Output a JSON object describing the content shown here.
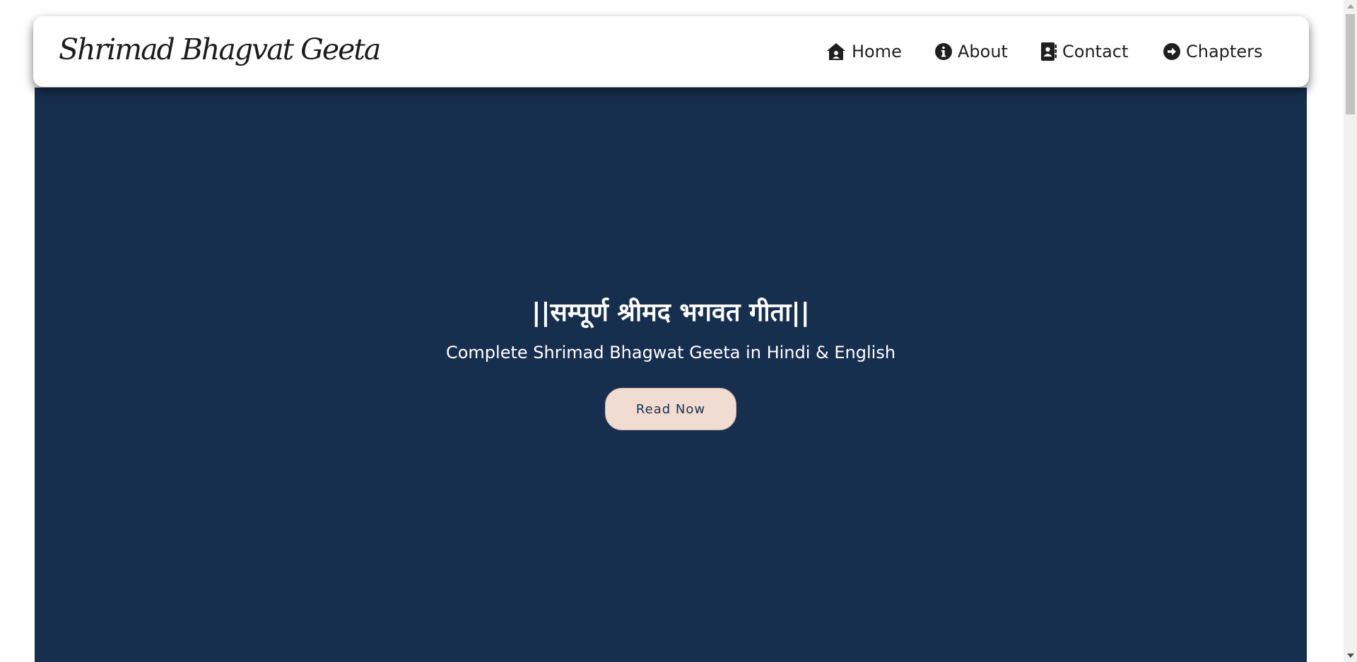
{
  "navbar": {
    "brand": "Shrimad Bhagvat Geeta",
    "items": [
      {
        "label": "Home",
        "icon": "home-icon"
      },
      {
        "label": "About",
        "icon": "info-circle-icon"
      },
      {
        "label": "Contact",
        "icon": "contact-book-icon"
      },
      {
        "label": "Chapters",
        "icon": "arrow-right-circle-icon"
      }
    ]
  },
  "hero": {
    "title": "||सम्पूर्ण श्रीमद भगवत गीता||",
    "subtitle": "Complete Shrimad Bhagwat Geeta in Hindi & English",
    "cta_label": "Read Now",
    "background_color": "#172f4f",
    "cta_color": "#f1dcd2"
  }
}
